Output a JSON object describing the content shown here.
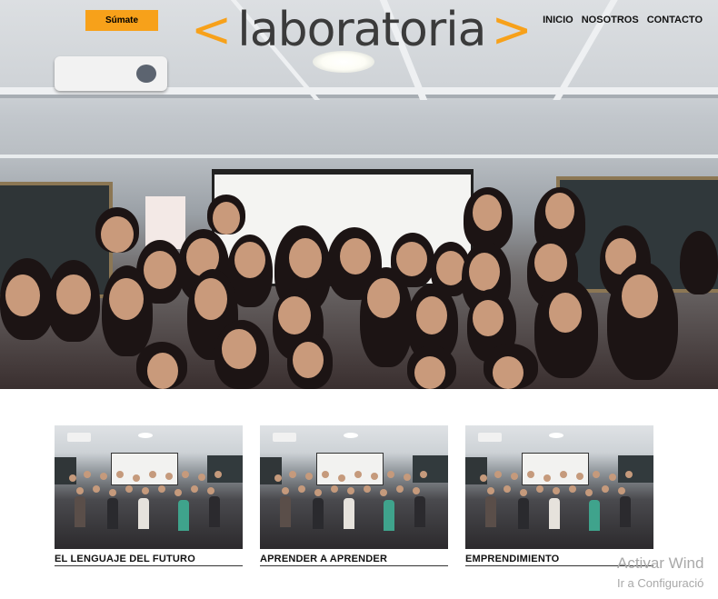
{
  "header": {
    "join_label": "Súmate",
    "logo": {
      "bracket_left": "<",
      "word": "laboratoria",
      "bracket_right": ">"
    },
    "nav": [
      "INICIO",
      "NOSOTROS",
      "CONTACTO"
    ]
  },
  "colors": {
    "accent": "#f7a11a",
    "text": "#111111",
    "logo_gray": "#3b3b3b"
  },
  "hero": {
    "image": "group-photo"
  },
  "cards": [
    {
      "title": "EL LENGUAJE DEL FUTURO",
      "image": "group-photo"
    },
    {
      "title": "APRENDER A APRENDER",
      "image": "group-photo"
    },
    {
      "title": "EMPRENDIMIENTO",
      "image": "group-photo"
    }
  ],
  "watermark": {
    "line1": "Activar Wind",
    "line2": "Ir a Configuració"
  }
}
